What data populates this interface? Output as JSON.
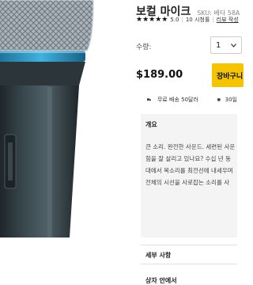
{
  "product": {
    "title": "보컬 마이크",
    "sku": "SKU: 베타 58A",
    "rating": "5.0",
    "review_count": "10 시청률",
    "review_link": "리뷰 작성"
  },
  "purchase": {
    "qty_label": "수량:",
    "qty_value": "1",
    "price": "$189.00",
    "cart_label": "장바구니"
  },
  "shipping": {
    "free_shipping": "무료 배송 50달러",
    "guarantee": "30일"
  },
  "overview": {
    "heading": "개요",
    "lines": [
      "큰 소리. 완전한 사운드. 세련된 사운",
      "힘을 잘 살리고 있나요? 수십 년 동",
      "대에서 목소리를 최전선에 내세우며",
      "전체의 시선을 사로잡는 소리를 사"
    ]
  },
  "sections": {
    "details": "세부 사항",
    "box_contents": "상자 안에서"
  },
  "colors": {
    "accent": "#f5c400",
    "panel_bg": "#f4f4f4",
    "mic_grille": "#9aa3ab",
    "mic_ring": "#3aa6d6",
    "mic_body": "#2a3236"
  },
  "icons": [
    "chevron-down-icon",
    "truck-icon",
    "shield-icon",
    "star-icon"
  ]
}
